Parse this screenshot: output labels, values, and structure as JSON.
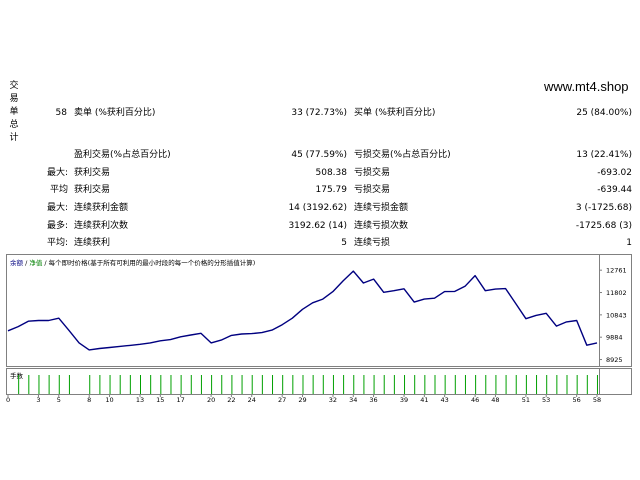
{
  "side_label": [
    "交",
    "易",
    "单",
    "总",
    "计"
  ],
  "site": "www.mt4.shop",
  "rows": [
    {
      "left_label": "",
      "total": "58",
      "label1": "卖单 (%获利百分比)",
      "value1": "33 (72.73%)",
      "label2": "买单 (%获利百分比)",
      "value2": "25 (84.00%)"
    },
    {
      "left_label": "",
      "total": "",
      "label1": "盈利交易(%占总百分比)",
      "value1": "45 (77.59%)",
      "label2": "亏损交易(%占总百分比)",
      "value2": "13 (22.41%)"
    },
    {
      "left_label": "最大:",
      "total": "",
      "label1": "获利交易",
      "value1": "508.38",
      "label2": "亏损交易",
      "value2": "-693.02"
    },
    {
      "left_label": "平均",
      "total": "",
      "label1": "获利交易",
      "value1": "175.79",
      "label2": "亏损交易",
      "value2": "-639.44"
    },
    {
      "left_label": "最大:",
      "total": "",
      "label1": "连续获利金额",
      "value1": "14 (3192.62)",
      "label2": "连续亏损金额",
      "value2": "3 (-1725.68)"
    },
    {
      "left_label": "最多:",
      "total": "",
      "label1": "连续获利次数",
      "value1": "3192.62 (14)",
      "label2": "连续亏损次数",
      "value2": "-1725.68 (3)"
    },
    {
      "left_label": "平均:",
      "total": "",
      "label1": "连续获利",
      "value1": "5",
      "label2": "连续亏损",
      "value2": "1"
    }
  ],
  "chart_header": {
    "balance": "余额",
    "separator1": " / ",
    "equity": "净值",
    "separator2": " / ",
    "description": "每个即时价格(基于所有可利用的最小时段的每一个价格的分形插值计算)"
  },
  "lots_label": "手数",
  "chart_data": {
    "type": "line",
    "x": [
      0,
      1,
      2,
      3,
      4,
      5,
      6,
      7,
      8,
      9,
      10,
      11,
      12,
      13,
      14,
      15,
      16,
      17,
      18,
      19,
      20,
      21,
      22,
      23,
      24,
      25,
      26,
      27,
      28,
      29,
      30,
      31,
      32,
      33,
      34,
      35,
      36,
      37,
      38,
      39,
      40,
      41,
      42,
      43,
      44,
      45,
      46,
      47,
      48,
      49,
      50,
      51,
      52,
      53,
      54,
      55,
      56,
      57,
      58
    ],
    "series": [
      {
        "values": [
          10160,
          10340,
          10570,
          10600,
          10600,
          10700,
          10180,
          9640,
          9340,
          9400,
          9440,
          9490,
          9530,
          9580,
          9640,
          9730,
          9780,
          9900,
          9980,
          10050,
          9640,
          9760,
          9960,
          10020,
          10040,
          10080,
          10190,
          10420,
          10700,
          11080,
          11360,
          11520,
          11840,
          12300,
          12720,
          12210,
          12380,
          11810,
          11880,
          11960,
          11390,
          11520,
          11560,
          11840,
          11850,
          12070,
          12530,
          11880,
          11950,
          11970,
          11330,
          10680,
          10820,
          10910,
          10360,
          10540,
          10600,
          9540,
          9640
        ],
        "color": "#000080"
      }
    ],
    "y_ticks": [
      12761,
      11802,
      10843,
      9884,
      8925
    ],
    "x_ticks": [
      0,
      3,
      5,
      8,
      10,
      13,
      15,
      17,
      20,
      22,
      24,
      27,
      29,
      32,
      34,
      36,
      39,
      41,
      43,
      46,
      48,
      51,
      53,
      56,
      58
    ],
    "xlim": [
      0,
      58.2
    ],
    "ylim": [
      8690,
      13370
    ],
    "lots_bar_color": "#00a000",
    "lots_bars": [
      1,
      2,
      3,
      4,
      5,
      6,
      8,
      9,
      10,
      11,
      12,
      13,
      14,
      15,
      16,
      17,
      18,
      19,
      20,
      21,
      22,
      23,
      24,
      25,
      26,
      27,
      28,
      29,
      30,
      31,
      32,
      33,
      34,
      35,
      36,
      37,
      38,
      39,
      40,
      41,
      42,
      43,
      44,
      45,
      46,
      47,
      48,
      49,
      50,
      51,
      52,
      53,
      54,
      55,
      56,
      57,
      58
    ]
  }
}
